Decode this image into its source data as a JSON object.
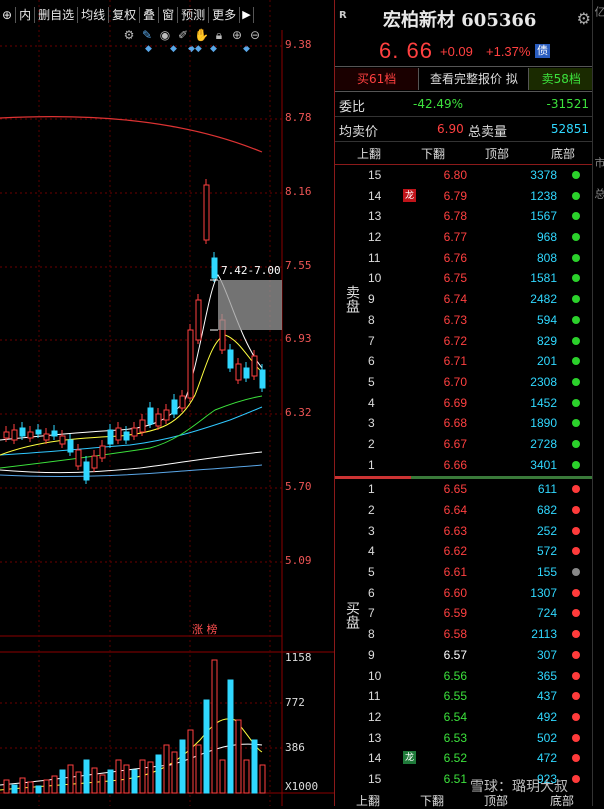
{
  "toolbar": {
    "items": [
      "内",
      "删自选",
      "均线",
      "复权",
      "叠",
      "窗",
      "预测",
      "更多"
    ],
    "play_icon": "▶"
  },
  "chart": {
    "price_levels": [
      "9.38",
      "8.78",
      "8.16",
      "7.55",
      "6.93",
      "6.32",
      "5.70",
      "5.09"
    ],
    "volume_levels": [
      "1158",
      "772",
      "386"
    ],
    "volume_unit": "X1000",
    "range_annotation": "7.42-7.00",
    "rank_badge": "涨 榜"
  },
  "quote": {
    "market_tag": "R",
    "title": "宏柏新材 605366",
    "last_price": "6. 66",
    "change": "+0.09",
    "change_pct": "+1.37%",
    "bond_badge": "债",
    "tabs": {
      "buy": "买61档",
      "detail": "查看完整报价 拟",
      "sell": "卖58档"
    },
    "weibi_label": "委比",
    "weibi_pct": "-42.49%",
    "weibi_diff": "-31521",
    "avg_label": "均卖价",
    "avg_price": "6.90",
    "total_sell_label": "总卖量",
    "total_sell": "52851",
    "col_headers": [
      "上翻",
      "下翻",
      "顶部",
      "底部"
    ],
    "sell_side_label": "卖盘",
    "buy_side_label": "买盘",
    "dragon_tag": "龙",
    "footer": [
      "上翻",
      "下翻",
      "顶部",
      "底部"
    ],
    "watermark": "雪球：璐玥大叔",
    "sell_orders": [
      {
        "lvl": "15",
        "price": "6.80",
        "vol": "3378",
        "dot": "#2bd12b"
      },
      {
        "lvl": "14",
        "price": "6.79",
        "vol": "1238",
        "dot": "#2bd12b",
        "tag": "龙",
        "tag_color": "#c0141a"
      },
      {
        "lvl": "13",
        "price": "6.78",
        "vol": "1567",
        "dot": "#2bd12b"
      },
      {
        "lvl": "12",
        "price": "6.77",
        "vol": "968",
        "dot": "#2bd12b"
      },
      {
        "lvl": "11",
        "price": "6.76",
        "vol": "808",
        "dot": "#2bd12b"
      },
      {
        "lvl": "10",
        "price": "6.75",
        "vol": "1581",
        "dot": "#2bd12b"
      },
      {
        "lvl": "9",
        "price": "6.74",
        "vol": "2482",
        "dot": "#2bd12b"
      },
      {
        "lvl": "8",
        "price": "6.73",
        "vol": "594",
        "dot": "#2bd12b"
      },
      {
        "lvl": "7",
        "price": "6.72",
        "vol": "829",
        "dot": "#2bd12b"
      },
      {
        "lvl": "6",
        "price": "6.71",
        "vol": "201",
        "dot": "#2bd12b"
      },
      {
        "lvl": "5",
        "price": "6.70",
        "vol": "2308",
        "dot": "#2bd12b"
      },
      {
        "lvl": "4",
        "price": "6.69",
        "vol": "1452",
        "dot": "#2bd12b"
      },
      {
        "lvl": "3",
        "price": "6.68",
        "vol": "1890",
        "dot": "#2bd12b"
      },
      {
        "lvl": "2",
        "price": "6.67",
        "vol": "2728",
        "dot": "#2bd12b"
      },
      {
        "lvl": "1",
        "price": "6.66",
        "vol": "3401",
        "dot": "#2bd12b"
      }
    ],
    "buy_orders": [
      {
        "lvl": "1",
        "price": "6.65",
        "vol": "611",
        "dot": "#ff3b3b",
        "price_color": "#ff4040"
      },
      {
        "lvl": "2",
        "price": "6.64",
        "vol": "682",
        "dot": "#ff3b3b",
        "price_color": "#ff4040"
      },
      {
        "lvl": "3",
        "price": "6.63",
        "vol": "252",
        "dot": "#ff3b3b",
        "price_color": "#ff4040"
      },
      {
        "lvl": "4",
        "price": "6.62",
        "vol": "572",
        "dot": "#ff3b3b",
        "price_color": "#ff4040"
      },
      {
        "lvl": "5",
        "price": "6.61",
        "vol": "155",
        "dot": "#888888",
        "price_color": "#ff4040"
      },
      {
        "lvl": "6",
        "price": "6.60",
        "vol": "1307",
        "dot": "#ff3b3b",
        "price_color": "#ff4040"
      },
      {
        "lvl": "7",
        "price": "6.59",
        "vol": "724",
        "dot": "#ff3b3b",
        "price_color": "#ff4040"
      },
      {
        "lvl": "8",
        "price": "6.58",
        "vol": "2113",
        "dot": "#ff3b3b",
        "price_color": "#ff4040"
      },
      {
        "lvl": "9",
        "price": "6.57",
        "vol": "307",
        "dot": "#ff3b3b",
        "price_color": "#ffffff"
      },
      {
        "lvl": "10",
        "price": "6.56",
        "vol": "365",
        "dot": "#ff3b3b",
        "price_color": "#3ce13c"
      },
      {
        "lvl": "11",
        "price": "6.55",
        "vol": "437",
        "dot": "#ff3b3b",
        "price_color": "#3ce13c"
      },
      {
        "lvl": "12",
        "price": "6.54",
        "vol": "492",
        "dot": "#ff3b3b",
        "price_color": "#3ce13c"
      },
      {
        "lvl": "13",
        "price": "6.53",
        "vol": "502",
        "dot": "#ff3b3b",
        "price_color": "#3ce13c"
      },
      {
        "lvl": "14",
        "price": "6.52",
        "vol": "472",
        "dot": "#ff3b3b",
        "price_color": "#3ce13c",
        "tag": "龙",
        "tag_color": "#1f7a3a"
      },
      {
        "lvl": "15",
        "price": "6.51",
        "vol": "923",
        "dot": "#ff3b3b",
        "price_color": "#3ce13c"
      }
    ]
  },
  "side_strip": [
    "亿",
    "市",
    "总"
  ]
}
